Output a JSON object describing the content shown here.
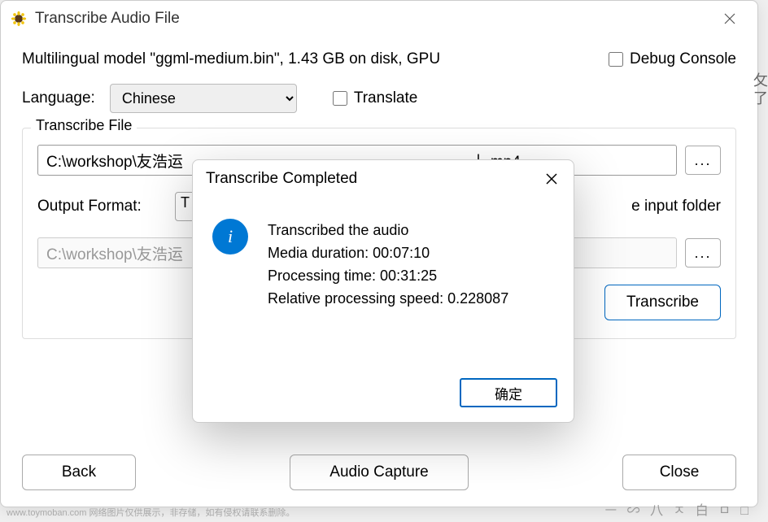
{
  "window": {
    "title": "Transcribe Audio File",
    "model_info": "Multilingual model \"ggml-medium.bin\", 1.43 GB on disk, GPU",
    "debug_label": "Debug Console",
    "language_label": "Language:",
    "language_value": "Chinese",
    "translate_label": "Translate"
  },
  "group": {
    "title": "Transcribe File",
    "input_path_visible": "C:\\workshop\\友浩运                                                                   丨.mp4",
    "browse": "...",
    "output_format_label": "Output Format:",
    "output_format_value": "T",
    "input_folder_label": "e input folder",
    "output_path_visible": "C:\\workshop\\友浩运                                                                   丨.txt"
  },
  "buttons": {
    "transcribe": "Transcribe",
    "back": "Back",
    "audio_capture": "Audio Capture",
    "close": "Close"
  },
  "dialog": {
    "title": "Transcribe Completed",
    "line1": "Transcribed the audio",
    "line2": "Media duration: 00:07:10",
    "line3": "Processing time: 00:31:25",
    "line4": "Relative processing speed: 0.228087",
    "ok": "确定"
  },
  "watermark": "www.toymoban.com 网络图片仅供展示，非存储，如有侵权请联系删除。",
  "side_chars": "攵\n了",
  "gray_bits": "ㅡ ∽ 八 ㅈ 白 ㅁ □"
}
